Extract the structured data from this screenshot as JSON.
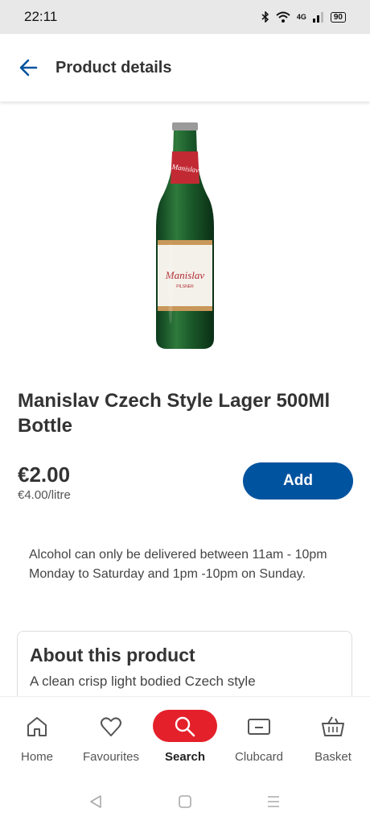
{
  "status": {
    "time": "22:11",
    "battery": "90",
    "network": "4G"
  },
  "header": {
    "title": "Product details"
  },
  "product": {
    "name": "Manislav Czech Style Lager 500Ml Bottle",
    "price": "€2.00",
    "unit_price": "€4.00/litre",
    "add_label": "Add",
    "label_brand": "Manislav",
    "label_sub": "PILSNER"
  },
  "alcohol_notice": "Alcohol can only be delivered between 11am - 10pm Monday to Saturday and 1pm -10pm on Sunday.",
  "about": {
    "heading": "About this product",
    "text": "A clean crisp light bodied Czech style"
  },
  "nav": {
    "items": [
      {
        "label": "Home",
        "icon": "home-icon"
      },
      {
        "label": "Favourites",
        "icon": "heart-icon"
      },
      {
        "label": "Search",
        "icon": "search-icon",
        "active": true
      },
      {
        "label": "Clubcard",
        "icon": "clubcard-icon"
      },
      {
        "label": "Basket",
        "icon": "basket-icon"
      }
    ]
  },
  "colors": {
    "primary": "#00539f",
    "accent": "#e4202a"
  }
}
